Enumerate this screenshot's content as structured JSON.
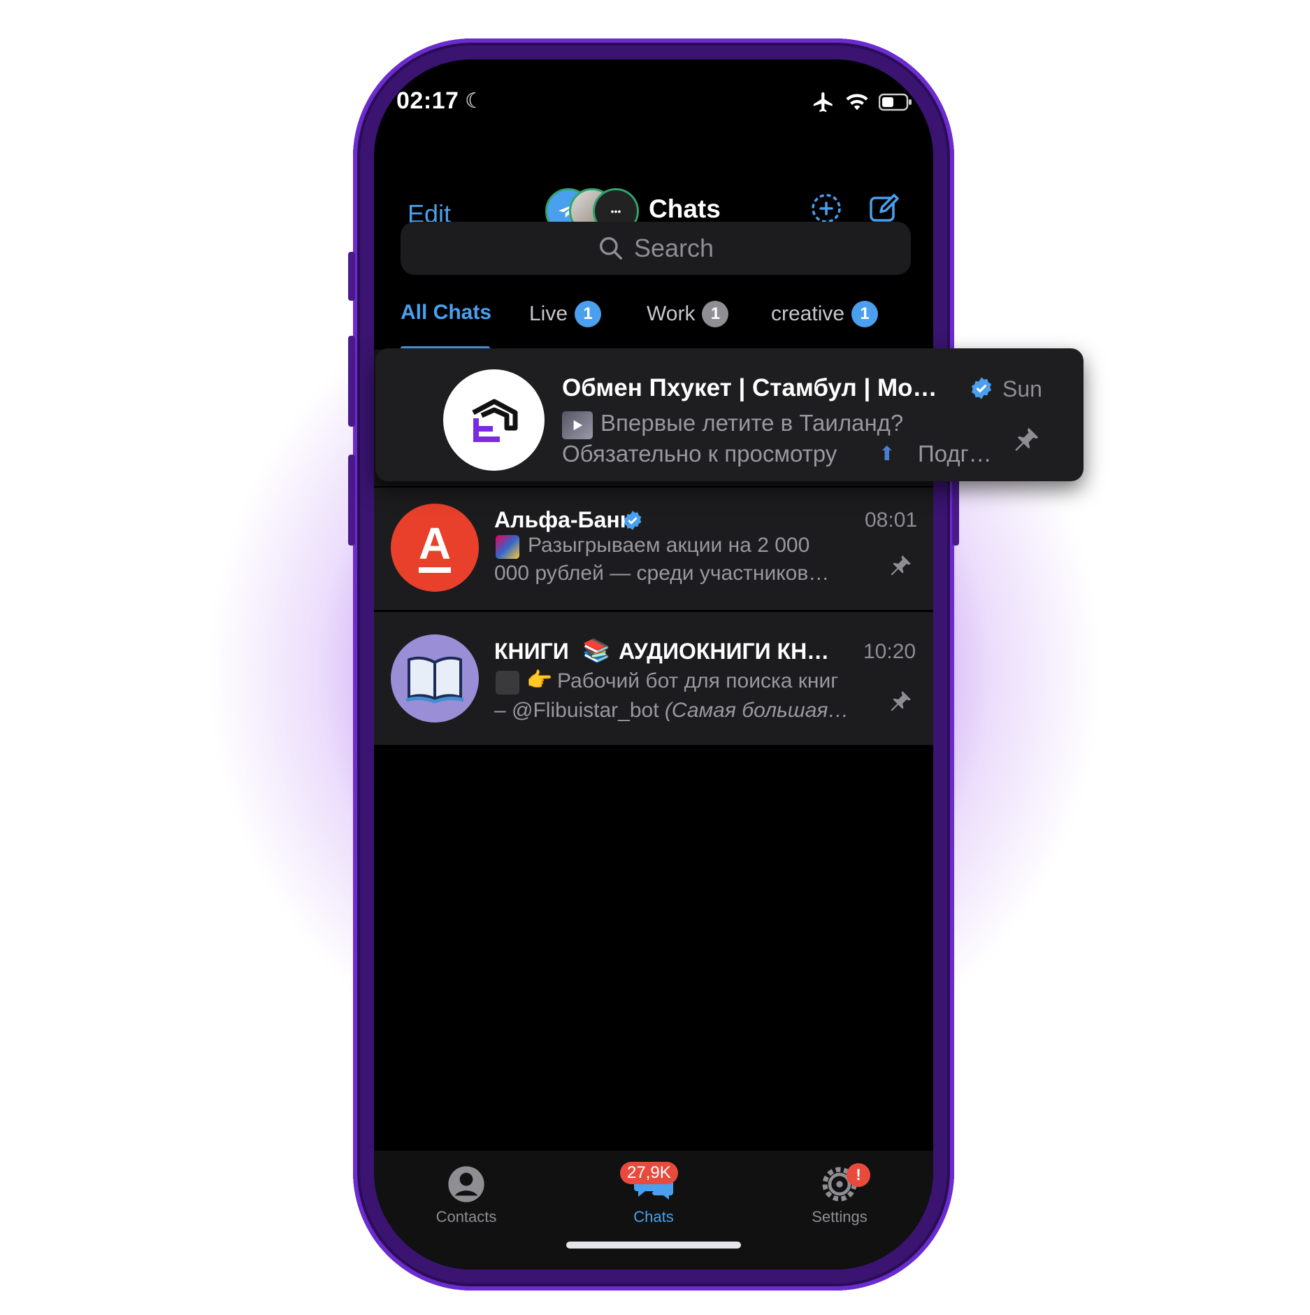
{
  "status_bar": {
    "time": "02:17"
  },
  "header": {
    "edit_label": "Edit",
    "title": "Chats"
  },
  "search": {
    "placeholder": "Search"
  },
  "folders": [
    {
      "label": "All Chats",
      "count": ""
    },
    {
      "label": "Live",
      "count": "1"
    },
    {
      "label": "Work",
      "count": "1"
    },
    {
      "label": "creative",
      "count": "1"
    }
  ],
  "chats": [
    {
      "name": "Обмен Пхукет | Стамбул | Мо…",
      "time": "Sun",
      "message_line1": "Впервые летите в Таиланд?",
      "message_line2": "Обязательно к просмотру",
      "message_tail": "Подг…",
      "verified": true,
      "pinned": true
    },
    {
      "name": "Альфа-Банк",
      "time": "08:01",
      "message_line1": "Разыгрываем акции на 2 000",
      "message_line2": "000 рублей — среди участников…",
      "avatar_letter": "А",
      "verified": true,
      "pinned": true
    },
    {
      "name": "КНИГИ",
      "name_tail": "АУДИОКНИГИ КН…",
      "time": "10:20",
      "message_line1": "Рабочий бот для поиска книг",
      "message_line2_plain": "– @Flibuistar_bot",
      "message_line2_italic": "(Самая большая…",
      "pinned": true
    }
  ],
  "tab_bar": {
    "contacts_label": "Contacts",
    "chats_label": "Chats",
    "chats_badge": "27,9K",
    "settings_label": "Settings",
    "settings_badge": "!"
  },
  "colors": {
    "accent": "#4aa0ee",
    "phone_frame": "#5a1fb0",
    "badge_red": "#e84b3c",
    "alfa_red": "#e8402a",
    "books_purple": "#9a8ed6"
  },
  "icons": [
    "moon-icon",
    "airplane-icon",
    "wifi-icon",
    "battery-icon",
    "add-story-icon",
    "compose-icon",
    "search-icon",
    "verified-icon",
    "pin-icon",
    "contacts-icon",
    "chats-icon",
    "settings-icon"
  ]
}
